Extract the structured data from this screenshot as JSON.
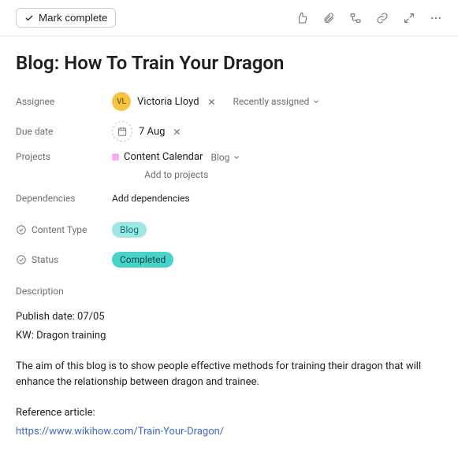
{
  "toolbar": {
    "mark_complete": "Mark complete"
  },
  "title": "Blog: How To Train Your Dragon",
  "fields": {
    "assignee_label": "Assignee",
    "assignee": {
      "initials": "VL",
      "name": "Victoria Lloyd"
    },
    "recently_assigned": "Recently assigned",
    "due_label": "Due date",
    "due_value": "7 Aug",
    "projects_label": "Projects",
    "project_name": "Content Calendar",
    "section_name": "Blog",
    "add_projects": "Add to projects",
    "dependencies_label": "Dependencies",
    "add_dependencies": "Add dependencies",
    "content_type_label": "Content Type",
    "content_type_value": "Blog",
    "status_label": "Status",
    "status_value": "Completed",
    "description_label": "Description"
  },
  "description": {
    "line1": "Publish date: 07/05",
    "line2": "KW: Dragon training",
    "body": "The aim of this blog is to show people effective methods for training their dragon that will enhance the relationship between dragon and trainee.",
    "ref_label": "Reference article:",
    "ref_url": "https://www.wikihow.com/Train-Your-Dragon/"
  }
}
